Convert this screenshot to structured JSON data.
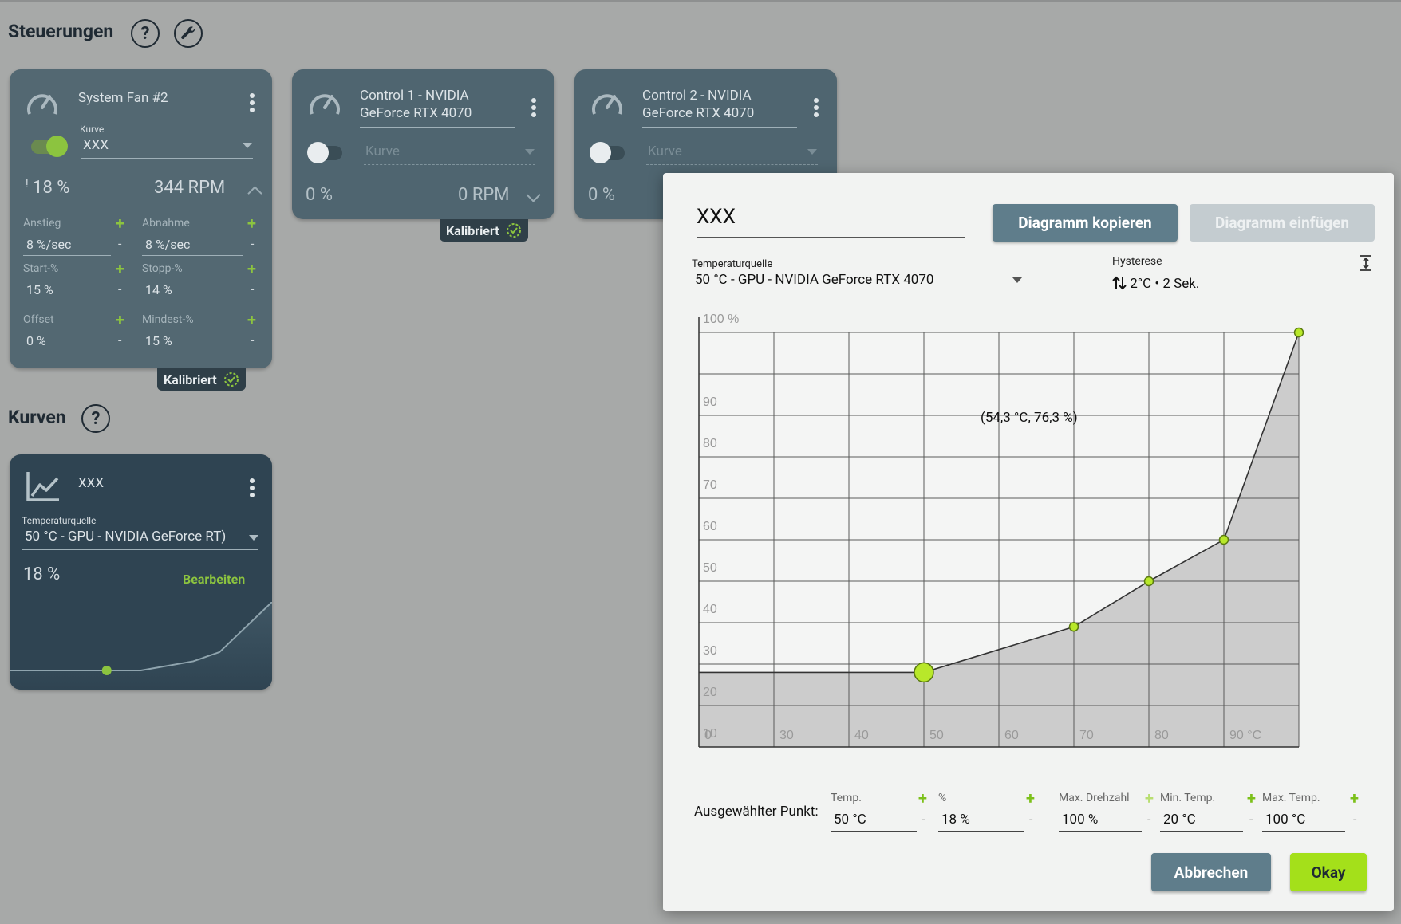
{
  "sections": {
    "controls_title": "Steuerungen",
    "curves_title": "Kurven"
  },
  "controls": [
    {
      "name": "System Fan #2",
      "curve_label": "Kurve",
      "curve_value": "XXX",
      "enabled": true,
      "duty_prefix": "!",
      "duty": "18 %",
      "rpm": "344 RPM",
      "params": [
        {
          "label": "Anstieg",
          "value": "8 %/sec"
        },
        {
          "label": "Abnahme",
          "value": "8 %/sec"
        },
        {
          "label": "Start-%",
          "value": "15 %"
        },
        {
          "label": "Stopp-%",
          "value": "14 %"
        },
        {
          "label": "Offset",
          "value": "0 %"
        },
        {
          "label": "Mindest-%",
          "value": "15 %"
        }
      ],
      "badge": "Kalibriert"
    },
    {
      "name_line1": "Control 1 - NVIDIA",
      "name_line2": "GeForce RTX 4070",
      "curve_placeholder": "Kurve",
      "enabled": false,
      "duty": "0 %",
      "rpm": "0 RPM",
      "badge": "Kalibriert"
    },
    {
      "name_line1": "Control 2 - NVIDIA",
      "name_line2": "GeForce RTX 4070",
      "curve_placeholder": "Kurve",
      "enabled": false,
      "duty": "0 %"
    }
  ],
  "curves": [
    {
      "name": "XXX",
      "source_label": "Temperaturquelle",
      "source_value": "50 °C - GPU - NVIDIA GeForce RT)",
      "duty": "18 %",
      "edit_label": "Bearbeiten"
    }
  ],
  "editor": {
    "name": "XXX",
    "copy_label": "Diagramm kopieren",
    "paste_label": "Diagramm einfügen",
    "source_label": "Temperaturquelle",
    "source_value": "50 °C - GPU - NVIDIA GeForce RTX 4070",
    "hysteresis_label": "Hysterese",
    "hysteresis_value": "2°C • 2 Sek.",
    "cursor_readout": "(54,3 °C, 76,3 %)",
    "selected_point_label": "Ausgewählter Punkt:",
    "point_fields": [
      {
        "label": "Temp.",
        "value": "50 °C"
      },
      {
        "label": "%",
        "value": "18 %"
      },
      {
        "label": "Max. Drehzahl",
        "value": "100 %"
      },
      {
        "label": "Min. Temp.",
        "value": "20 °C"
      },
      {
        "label": "Max. Temp.",
        "value": "100 °C"
      }
    ],
    "cancel_label": "Abbrechen",
    "ok_label": "Okay"
  },
  "chart_data": {
    "type": "area",
    "x": [
      20,
      50,
      70,
      80,
      90,
      100
    ],
    "y": [
      18,
      18,
      29,
      40,
      50,
      100
    ],
    "selected_index": 1,
    "xlim": [
      20,
      100
    ],
    "ylim": [
      0,
      100
    ],
    "x_ticks": [
      "0",
      "30",
      "40",
      "50",
      "60",
      "70",
      "80",
      "90 °C"
    ],
    "y_ticks": [
      "10",
      "20",
      "30",
      "40",
      "50",
      "60",
      "70",
      "80",
      "90",
      "100 %"
    ],
    "grid": true,
    "colors": {
      "line": "#333333",
      "fill": "#cccccc",
      "point": "#b8e82a",
      "point_stroke": "#5a7a10"
    }
  },
  "mini_chart": {
    "type": "line",
    "x": [
      0,
      50,
      70,
      80,
      100
    ],
    "y": [
      18,
      18,
      29,
      40,
      100
    ]
  }
}
